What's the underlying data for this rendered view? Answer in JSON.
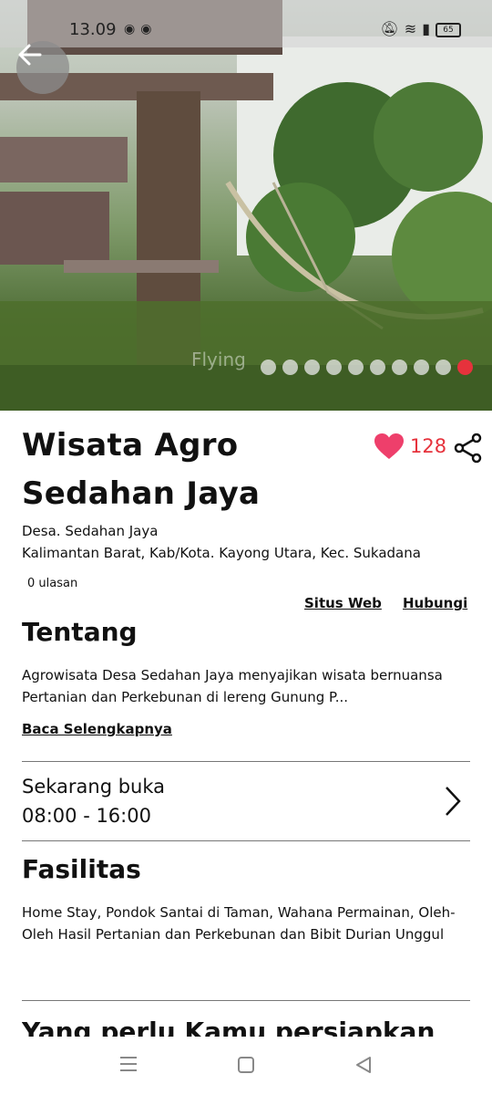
{
  "status_bar": {
    "time": "13.09",
    "battery": "65"
  },
  "hero": {
    "watermark": "Flying",
    "slide_count": 10,
    "active_slide": 10,
    "accent_color": "#e6323c"
  },
  "place": {
    "title": "Wisata Agro Sedahan Jaya",
    "likes": "128",
    "address_line1": "Desa. Sedahan Jaya",
    "address_line2": "Kalimantan Barat, Kab/Kota. Kayong Utara, Kec. Sukadana",
    "reviews": "0 ulasan"
  },
  "links": {
    "website": "Situs Web",
    "contact": "Hubungi"
  },
  "about": {
    "heading": "Tentang",
    "text": "Agrowisata Desa Sedahan Jaya menyajikan wisata bernuansa Pertanian dan Perkebunan di lereng Gunung P...",
    "read_more": "Baca Selengkapnya"
  },
  "hours": {
    "status": "Sekarang buka",
    "time": "08:00 - 16:00"
  },
  "facilities": {
    "heading": "Fasilitas",
    "text": "Home Stay, Pondok Santai di Taman, Wahana Permainan, Oleh-Oleh Hasil Pertanian dan Perkebunan dan Bibit Durian Unggul"
  },
  "next_section": {
    "heading": "Yang perlu Kamu persiapkan"
  },
  "icons": [
    "back-arrow-icon",
    "heart-icon",
    "share-icon",
    "chevron-right-icon",
    "menu-icon",
    "home-icon",
    "back-icon"
  ]
}
